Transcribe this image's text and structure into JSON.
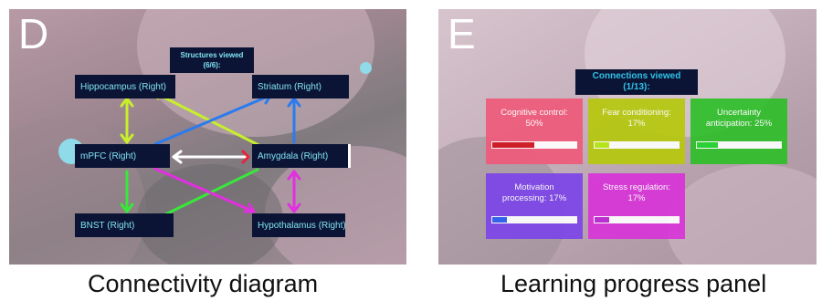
{
  "panel_d": {
    "letter": "D",
    "caption": "Connectivity diagram",
    "structures_viewed": {
      "line1": "Structures viewed",
      "line2": "(6/6):"
    },
    "nodes": {
      "hippocampus": "Hippocampus (Right)",
      "striatum": "Striatum (Right)",
      "mpfc": "mPFC (Right)",
      "amygdala": "Amygdala (Right)",
      "bnst": "BNST (Right)",
      "hypothalamus": "Hypothalamus (Right)"
    },
    "colors": {
      "node_bg": "#0c1436",
      "node_text": "#7fe3f2",
      "yellow_green": "#c8f02a",
      "green": "#38e83a",
      "blue": "#2a7bef",
      "magenta": "#e22fe0",
      "white": "#ffffff",
      "red": "#e8233b"
    }
  },
  "panel_e": {
    "letter": "E",
    "caption": "Learning progress panel",
    "connections_viewed": {
      "line1": "Connections viewed",
      "line2": "(1/13):"
    },
    "cards": [
      {
        "label": "Cognitive control:\n50%",
        "progress": 0.5,
        "color": "#ef5a7a",
        "fill": "#d0141e"
      },
      {
        "label": "Fear conditioning:\n17%",
        "progress": 0.17,
        "color": "#b6c80c",
        "fill": "#b5e80f"
      },
      {
        "label": "Uncertainty\nanticipation: 25%",
        "progress": 0.25,
        "color": "#2fbf2a",
        "fill": "#1fd52a"
      },
      {
        "label": "Motivation\nprocessing: 17%",
        "progress": 0.17,
        "color": "#7c45e8",
        "fill": "#2a5ef0"
      },
      {
        "label": "Stress regulation:\n17%",
        "progress": 0.17,
        "color": "#d834d8",
        "fill": "#bb27d2"
      }
    ]
  }
}
